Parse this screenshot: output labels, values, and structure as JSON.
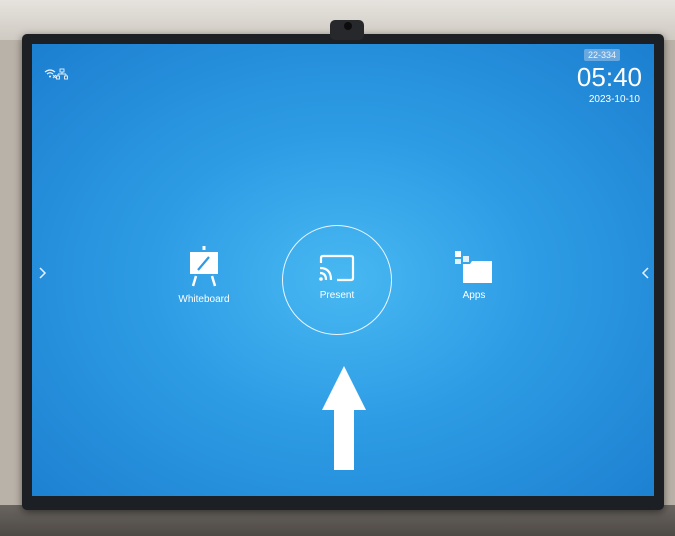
{
  "status_bar": {
    "network_icons": "wifi-off-icon ethernet-icon",
    "room_badge": "22-334",
    "time": "05:40",
    "date": "2023-10-10"
  },
  "home": {
    "tiles": [
      {
        "label": "Whiteboard",
        "icon": "easel-pen-icon"
      },
      {
        "label": "Present",
        "icon": "cast-icon",
        "selected": true
      },
      {
        "label": "Apps",
        "icon": "apps-folder-icon"
      }
    ],
    "nav_left": "‹",
    "nav_right": "‹"
  },
  "colors": {
    "screen_center": "#48b8f2",
    "screen_edge": "#1c7fd0",
    "text": "#ffffff"
  }
}
